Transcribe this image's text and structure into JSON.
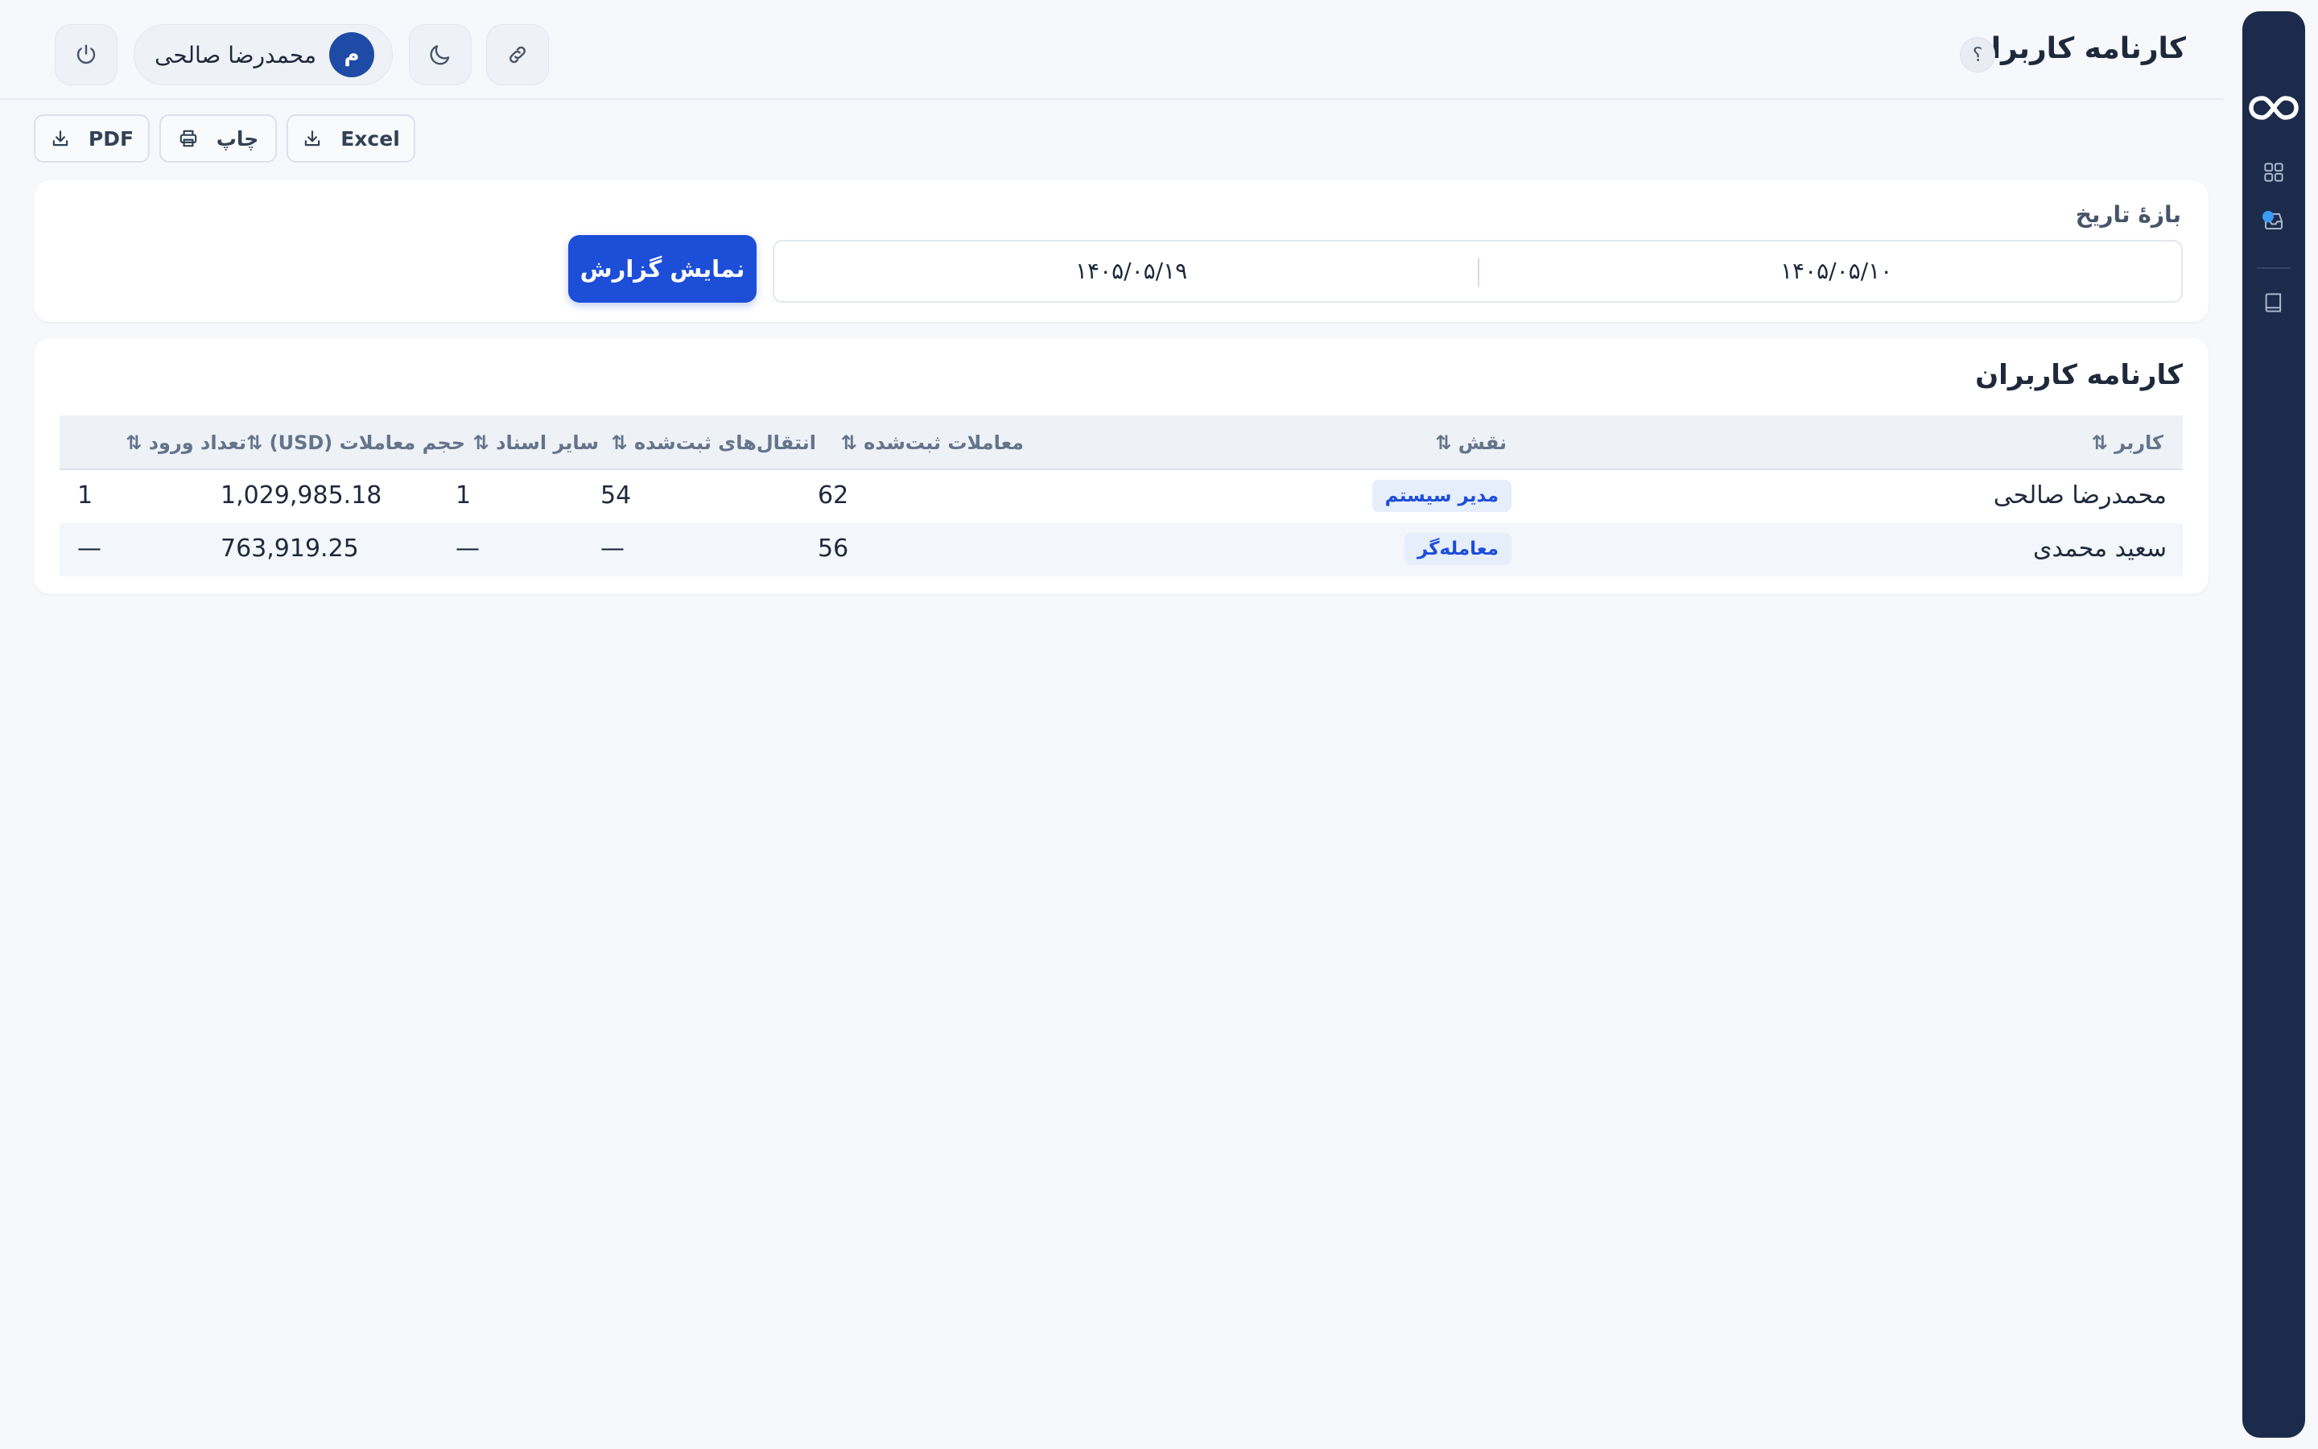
{
  "header": {
    "title": "کارنامه کاربران",
    "help": "؟",
    "user_name": "محمدرضا صالحی",
    "avatar_initial": "م"
  },
  "toolbar": {
    "excel_label": "Excel",
    "print_label": "چاپ",
    "pdf_label": "PDF"
  },
  "filter": {
    "label": "بازهٔ تاریخ",
    "date_from": "۱۴۰۵/۰۵/۱۰",
    "date_to": "۱۴۰۵/۰۵/۱۹",
    "show_button": "نمایش گزارش"
  },
  "table": {
    "title": "کارنامه کاربران",
    "columns": {
      "user": "کاربر",
      "role": "نقش",
      "trades": "معاملات ثبت‌شده",
      "transfers": "انتقال‌های ثبت‌شده",
      "other_docs": "سایر اسناد",
      "volume": "حجم معاملات (USD)",
      "logins": "تعداد ورود"
    },
    "sort_glyph": "⇅",
    "rows": [
      {
        "user": "محمدرضا صالحی",
        "role": "مدیر سیستم",
        "trades": "62",
        "transfers": "54",
        "other_docs": "1",
        "volume": "1,029,985.18",
        "logins": "1"
      },
      {
        "user": "سعید محمدی",
        "role": "معامله‌گر",
        "trades": "56",
        "transfers": "—",
        "other_docs": "—",
        "volume": "763,919.25",
        "logins": "—"
      }
    ]
  },
  "sidebar": {
    "icons": [
      "infinity-logo-icon",
      "dashboard-grid-icon",
      "inbox-icon",
      "book-icon"
    ]
  },
  "colors": {
    "sidebar_bg": "#1c2b4b",
    "accent": "#1d4ed8",
    "badge_bg": "#e6eefc",
    "notification_dot": "#3b9bf5"
  }
}
